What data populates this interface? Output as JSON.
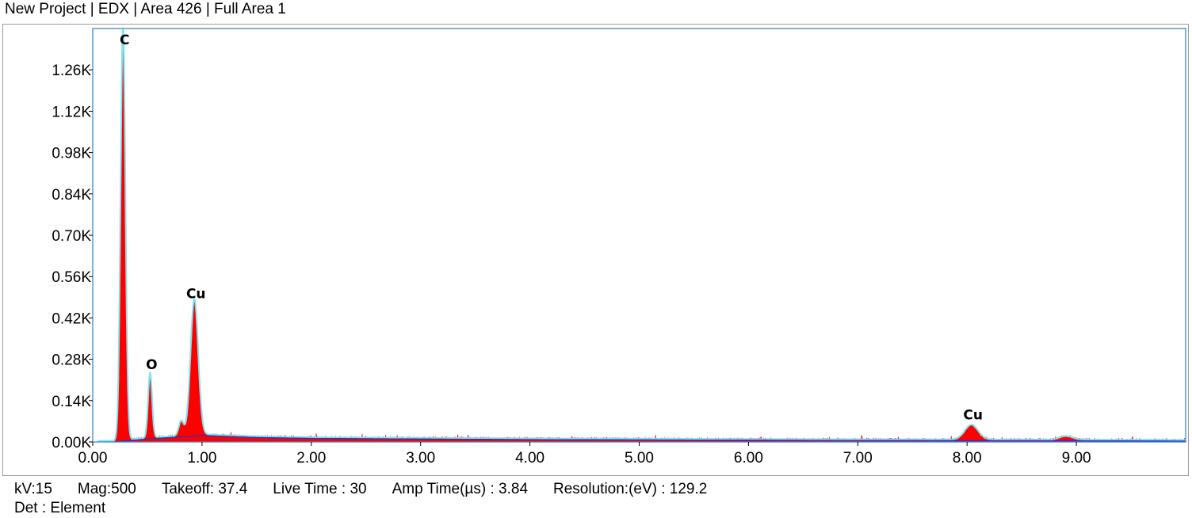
{
  "header": {
    "title": "New Project | EDX | Area 426 | Full Area 1"
  },
  "footer": {
    "kv": "kV:15",
    "mag": "Mag:500",
    "takeoff": "Takeoff: 37.4",
    "live_time": "Live Time : 30",
    "amp_time": "Amp Time(µs) : 3.84",
    "resolution": "Resolution:(eV) : 129.2",
    "det": "Det : Element"
  },
  "chart_data": {
    "type": "area",
    "xlim": [
      0,
      10.0
    ],
    "ylim": [
      0,
      1.4
    ],
    "x_ticks": [
      0,
      1,
      2,
      3,
      4,
      5,
      6,
      7,
      8,
      9
    ],
    "x_tick_labels": [
      "0.00",
      "1.00",
      "2.00",
      "3.00",
      "4.00",
      "5.00",
      "6.00",
      "7.00",
      "8.00",
      "9.00"
    ],
    "y_ticks": [
      0,
      0.14,
      0.28,
      0.42,
      0.56,
      0.7,
      0.84,
      0.98,
      1.12,
      1.26
    ],
    "y_tick_labels": [
      "0.00K",
      "0.14K",
      "0.28K",
      "0.42K",
      "0.56K",
      "0.70K",
      "0.84K",
      "0.98K",
      "1.12K",
      "1.26K"
    ],
    "y_unit": "K counts",
    "grid": false,
    "colors": {
      "spectrum": "#ff0000",
      "fit": "#7fe3f0",
      "background": "#2233cc",
      "axis": "#3a88c8"
    },
    "peaks": [
      {
        "label": "C",
        "energy": 0.277,
        "height": 1.4,
        "sigma": 0.022
      },
      {
        "label": "O",
        "energy": 0.525,
        "height": 0.22,
        "sigma": 0.018
      },
      {
        "label": "",
        "energy": 0.81,
        "height": 0.05,
        "sigma": 0.022
      },
      {
        "label": "Cu",
        "energy": 0.93,
        "height": 0.46,
        "sigma": 0.035
      },
      {
        "label": "Cu",
        "energy": 8.04,
        "height": 0.05,
        "sigma": 0.06
      },
      {
        "label": "",
        "energy": 8.905,
        "height": 0.012,
        "sigma": 0.06
      }
    ],
    "background_curve": {
      "x": [
        0.2,
        0.5,
        1.0,
        1.5,
        2.0,
        3.0,
        4.0,
        5.0,
        7.0,
        9.0,
        9.9
      ],
      "y": [
        0.0,
        0.01,
        0.022,
        0.015,
        0.012,
        0.01,
        0.008,
        0.007,
        0.005,
        0.004,
        0.003
      ]
    }
  }
}
